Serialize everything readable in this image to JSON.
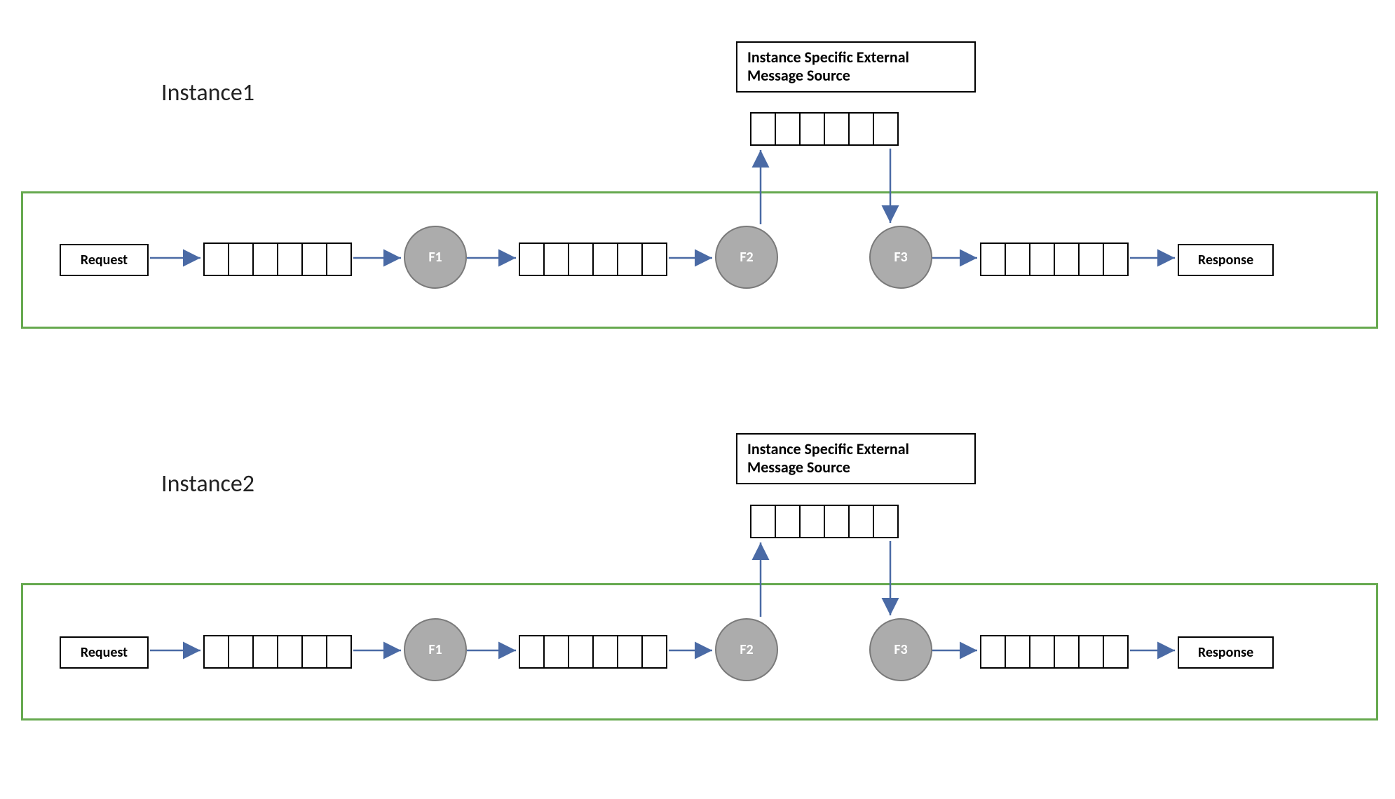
{
  "colors": {
    "arrow": "#4a6aa5",
    "instance_border": "#66a94f",
    "node_fill": "#acacac",
    "node_border": "#7a7a7a"
  },
  "instances": [
    {
      "title": "Instance1",
      "external_label_line1": "Instance Specific External",
      "external_label_line2": "Message Source",
      "request": "Request",
      "response": "Response",
      "nodes": {
        "f1": "F1",
        "f2": "F2",
        "f3": "F3"
      }
    },
    {
      "title": "Instance2",
      "external_label_line1": "Instance Specific External",
      "external_label_line2": "Message Source",
      "request": "Request",
      "response": "Response",
      "nodes": {
        "f1": "F1",
        "f2": "F2",
        "f3": "F3"
      }
    }
  ]
}
